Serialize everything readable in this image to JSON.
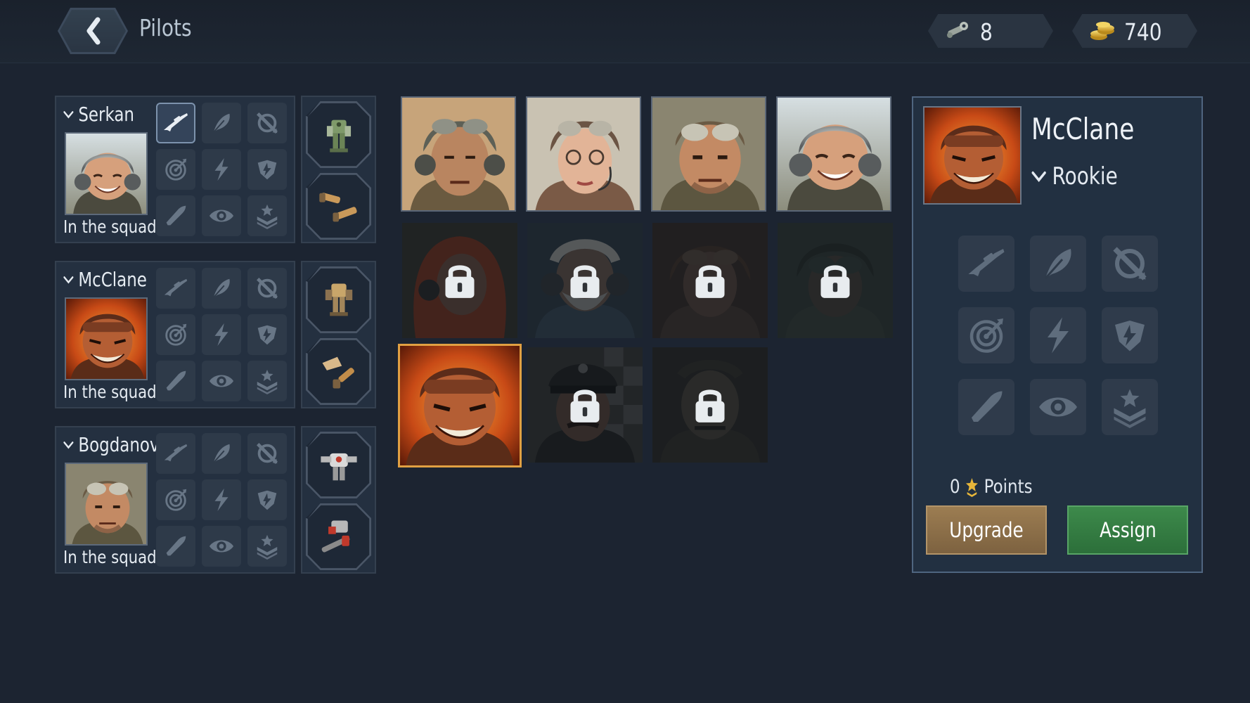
{
  "header": {
    "title": "Pilots",
    "currencies": [
      {
        "icon": "wrench-icon",
        "value": "8"
      },
      {
        "icon": "gold-coins-icon",
        "value": "740"
      }
    ]
  },
  "squad": [
    {
      "name": "Serkan",
      "status": "In the squad",
      "selected_skill": "sniper-rifle"
    },
    {
      "name": "McClane",
      "status": "In the squad",
      "selected_skill": ""
    },
    {
      "name": "Bogdanov",
      "status": "In the squad",
      "selected_skill": ""
    }
  ],
  "skills": [
    "sniper-rifle-icon",
    "feather-icon",
    "crossed-circle-icon",
    "target-icon",
    "lightning-icon",
    "shield-arrow-icon",
    "bullet-icon",
    "eye-icon",
    "rank-star-icon"
  ],
  "detail": {
    "name": "McClane",
    "rank": "Rookie",
    "points_value": "0",
    "points_label": "Points",
    "upgrade_label": "Upgrade",
    "assign_label": "Assign"
  },
  "colors": {
    "background": "#1c2431",
    "selected_border": "#e1a042",
    "upgrade_button": "#8b6f48",
    "assign_button": "#347d43"
  }
}
